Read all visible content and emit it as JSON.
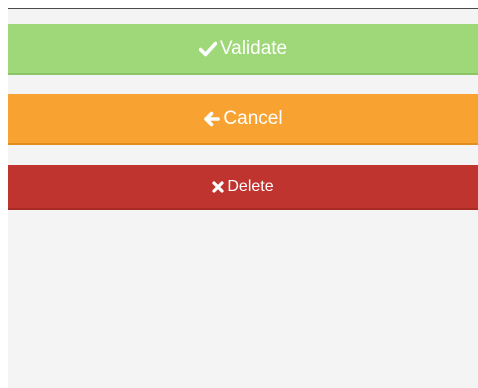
{
  "actions": {
    "validate": {
      "label": "Validate",
      "icon": "checkmark-icon",
      "color": "#9ed878"
    },
    "cancel": {
      "label": "Cancel",
      "icon": "arrow-left-icon",
      "color": "#f8a331"
    },
    "delete": {
      "label": "Delete",
      "icon": "close-icon",
      "color": "#c0342f"
    }
  }
}
